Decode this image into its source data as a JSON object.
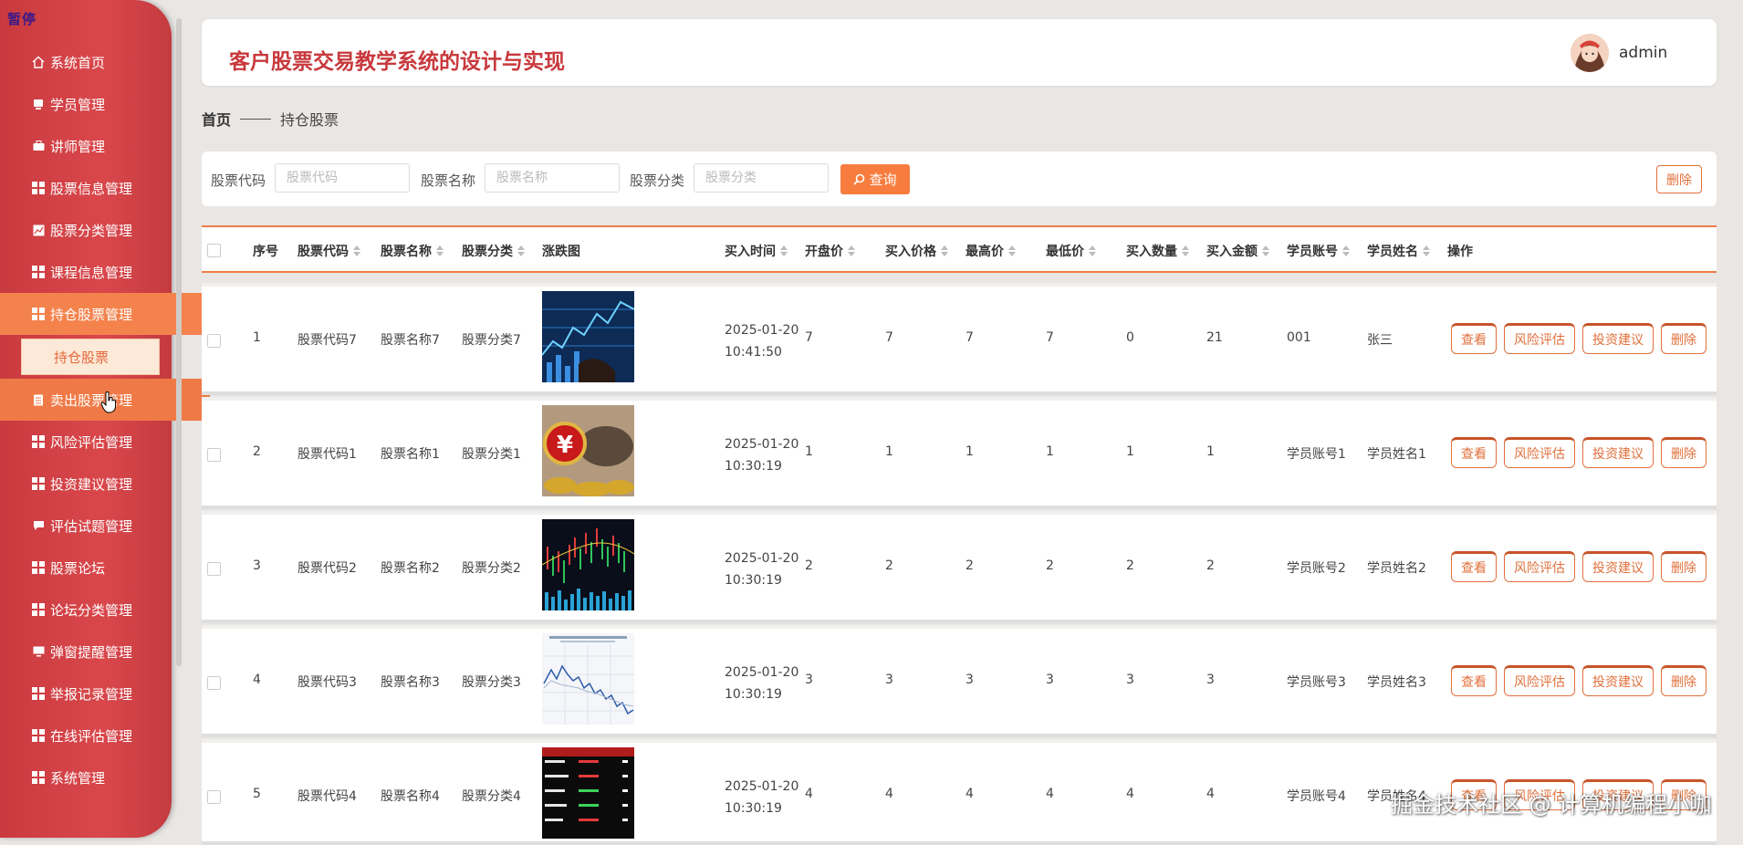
{
  "paused_label": "暂停",
  "sidebar": {
    "items": [
      {
        "label": "系统首页",
        "icon": "home-icon"
      },
      {
        "label": "学员管理",
        "icon": "document-icon"
      },
      {
        "label": "讲师管理",
        "icon": "briefcase-icon"
      },
      {
        "label": "股票信息管理",
        "icon": "grid-icon"
      },
      {
        "label": "股票分类管理",
        "icon": "chart-icon"
      },
      {
        "label": "课程信息管理",
        "icon": "grid-icon"
      },
      {
        "label": "持仓股票管理",
        "icon": "grid-icon"
      },
      {
        "label": "卖出股票管理",
        "icon": "document-icon"
      },
      {
        "label": "风险评估管理",
        "icon": "grid-icon"
      },
      {
        "label": "投资建议管理",
        "icon": "grid-icon"
      },
      {
        "label": "评估试题管理",
        "icon": "chat-icon"
      },
      {
        "label": "股票论坛",
        "icon": "grid-icon"
      },
      {
        "label": "论坛分类管理",
        "icon": "grid-icon"
      },
      {
        "label": "弹窗提醒管理",
        "icon": "monitor-icon"
      },
      {
        "label": "举报记录管理",
        "icon": "grid-icon"
      },
      {
        "label": "在线评估管理",
        "icon": "grid-icon"
      },
      {
        "label": "系统管理",
        "icon": "grid-icon"
      }
    ],
    "submenu_active": "持仓股票"
  },
  "header": {
    "title": "客户股票交易教学系统的设计与实现",
    "username": "admin"
  },
  "breadcrumb": {
    "home": "首页",
    "current": "持仓股票"
  },
  "search": {
    "code_label": "股票代码",
    "code_placeholder": "股票代码",
    "name_label": "股票名称",
    "name_placeholder": "股票名称",
    "category_label": "股票分类",
    "category_placeholder": "股票分类",
    "query_button": "查询",
    "delete_button": "删除"
  },
  "table": {
    "columns": {
      "index": "序号",
      "code": "股票代码",
      "name": "股票名称",
      "category": "股票分类",
      "chart": "涨跌图",
      "buy_time": "买入时间",
      "open": "开盘价",
      "buy_price": "买入价格",
      "high": "最高价",
      "low": "最低价",
      "qty": "买入数量",
      "amount": "买入金额",
      "student_id": "学员账号",
      "student_name": "学员姓名",
      "actions": "操作"
    },
    "action_labels": {
      "view": "查看",
      "risk": "风险评估",
      "advice": "投资建议",
      "delete": "删除"
    },
    "rows": [
      {
        "index": "1",
        "code": "股票代码7",
        "name": "股票名称7",
        "category": "股票分类7",
        "date": "2025-01-20",
        "time": "10:41:50",
        "open": "7",
        "buy_price": "7",
        "high": "7",
        "low": "7",
        "qty": "0",
        "amount": "21",
        "student_id": "001",
        "student_name": "张三"
      },
      {
        "index": "2",
        "code": "股票代码1",
        "name": "股票名称1",
        "category": "股票分类1",
        "date": "2025-01-20",
        "time": "10:30:19",
        "open": "1",
        "buy_price": "1",
        "high": "1",
        "low": "1",
        "qty": "1",
        "amount": "1",
        "student_id": "学员账号1",
        "student_name": "学员姓名1"
      },
      {
        "index": "3",
        "code": "股票代码2",
        "name": "股票名称2",
        "category": "股票分类2",
        "date": "2025-01-20",
        "time": "10:30:19",
        "open": "2",
        "buy_price": "2",
        "high": "2",
        "low": "2",
        "qty": "2",
        "amount": "2",
        "student_id": "学员账号2",
        "student_name": "学员姓名2"
      },
      {
        "index": "4",
        "code": "股票代码3",
        "name": "股票名称3",
        "category": "股票分类3",
        "date": "2025-01-20",
        "time": "10:30:19",
        "open": "3",
        "buy_price": "3",
        "high": "3",
        "low": "3",
        "qty": "3",
        "amount": "3",
        "student_id": "学员账号3",
        "student_name": "学员姓名3"
      },
      {
        "index": "5",
        "code": "股票代码4",
        "name": "股票名称4",
        "category": "股票分类4",
        "date": "2025-01-20",
        "time": "10:30:19",
        "open": "4",
        "buy_price": "4",
        "high": "4",
        "low": "4",
        "qty": "4",
        "amount": "4",
        "student_id": "学员账号4",
        "student_name": "学员姓名4"
      }
    ]
  },
  "watermark": "掘金技术社区 @ 计算机编程小咖",
  "colors": {
    "sidebar": "#d9474b",
    "accent": "#f77d3f",
    "title": "#c8393d"
  }
}
